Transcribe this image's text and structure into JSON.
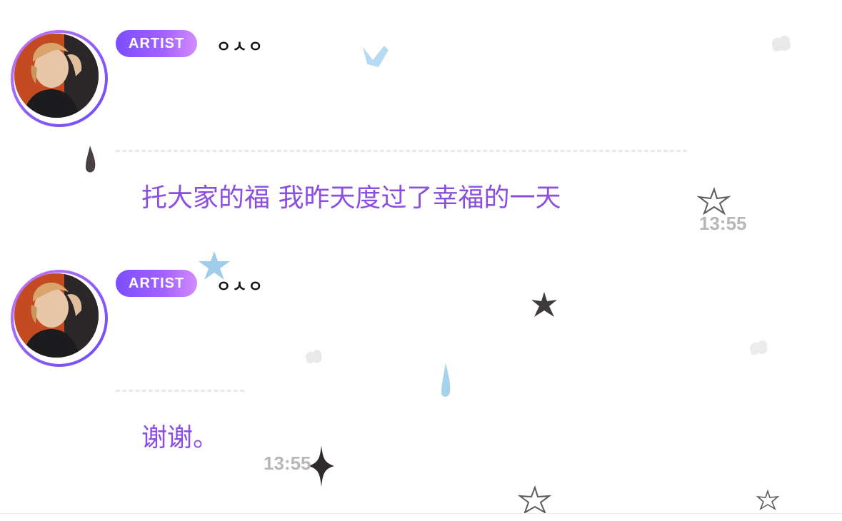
{
  "messages": [
    {
      "badge": "ARTIST",
      "sender": "ㅇㅅㅇ",
      "text": "托大家的福 我昨天度过了幸福的一天",
      "time": "13:55"
    },
    {
      "badge": "ARTIST",
      "sender": "ㅇㅅㅇ",
      "text": "谢谢。",
      "time": "13:55"
    }
  ],
  "colors": {
    "badge_gradient_start": "#7b4dff",
    "badge_gradient_end": "#d28bff",
    "message_text": "#8a4fe0",
    "timestamp": "#b7b7b7"
  },
  "icons": [
    "avatar",
    "star-doodle-icon",
    "raindrop-doodle-icon",
    "cloud-doodle-icon"
  ]
}
